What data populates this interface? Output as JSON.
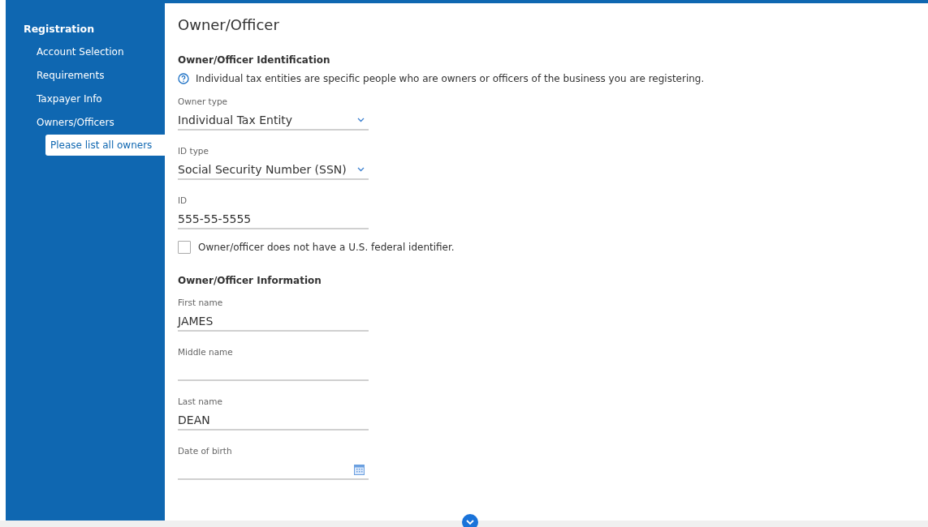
{
  "sidebar": {
    "heading": "Registration",
    "items": [
      {
        "label": "Account Selection",
        "selected": false
      },
      {
        "label": "Requirements",
        "selected": false
      },
      {
        "label": "Taxpayer Info",
        "selected": false
      },
      {
        "label": "Owners/Officers",
        "selected": false,
        "children": [
          {
            "label": "Please list all owners",
            "selected": true
          }
        ]
      }
    ]
  },
  "page_title": "Owner/Officer",
  "sections": [
    {
      "heading": "Owner/Officer Identification",
      "info": "Individual tax entities are specific people who are owners or officers of the business you are registering.",
      "items": [
        {
          "kind": "select",
          "label": "Owner type",
          "value": "Individual Tax Entity"
        },
        {
          "kind": "select",
          "label": "ID type",
          "value": "Social Security Number (SSN)"
        },
        {
          "kind": "text",
          "label": "ID",
          "value": "555-55-5555"
        },
        {
          "kind": "checkbox",
          "label": "Owner/officer does not have a U.S. federal identifier.",
          "checked": false
        }
      ]
    },
    {
      "heading": "Owner/Officer Information",
      "items": [
        {
          "kind": "text",
          "label": "First name",
          "value": "JAMES"
        },
        {
          "kind": "text",
          "label": "Middle name"
        },
        {
          "kind": "text",
          "label": "Last name",
          "value": "DEAN"
        },
        {
          "kind": "date",
          "label": "Date of birth"
        }
      ]
    }
  ]
}
